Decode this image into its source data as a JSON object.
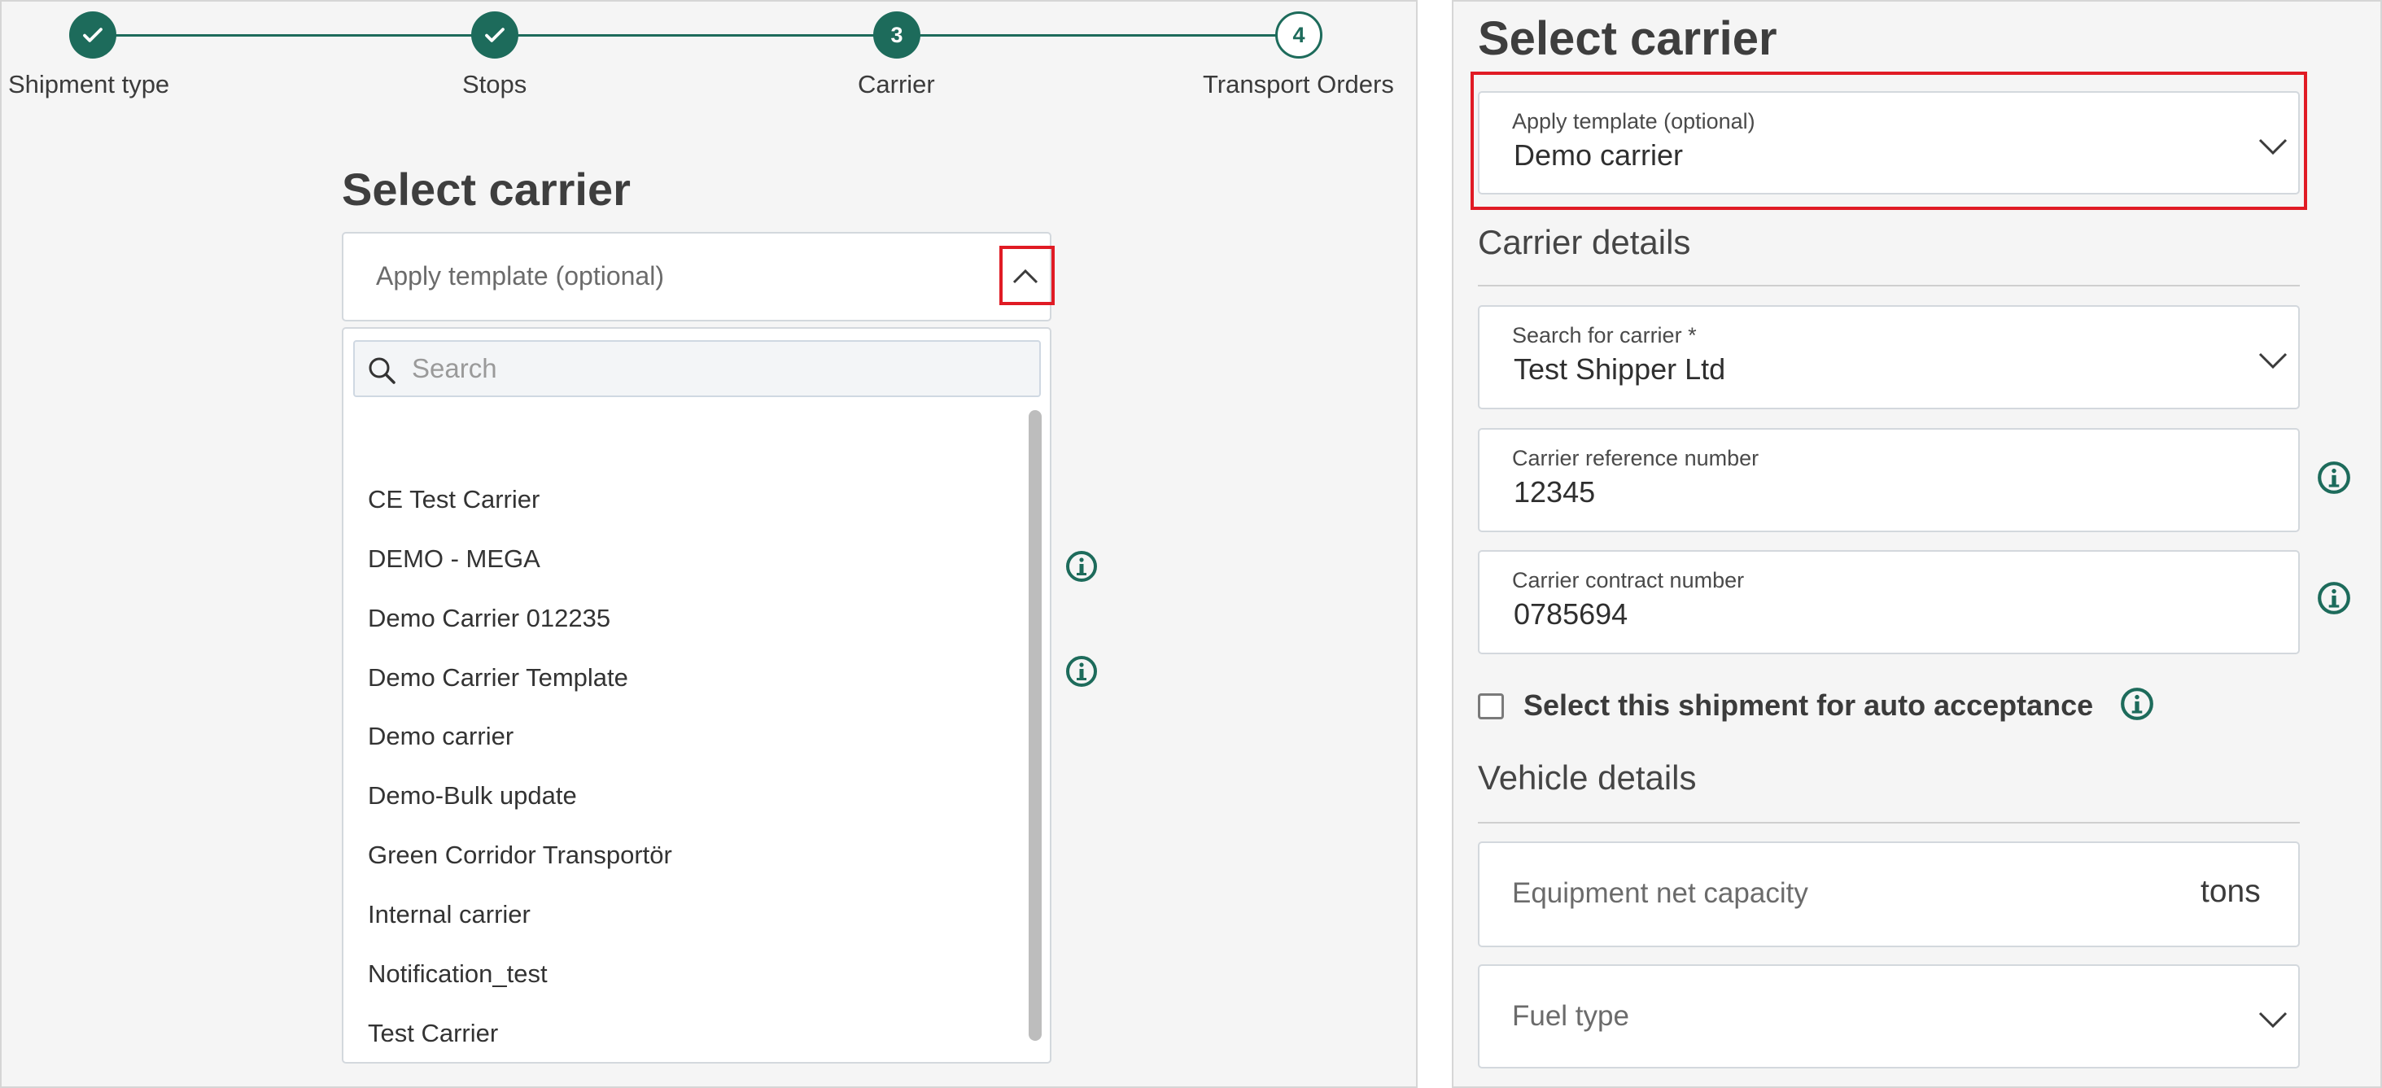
{
  "stepper": {
    "steps": [
      {
        "label": "Shipment type",
        "state": "done",
        "marker": "✓"
      },
      {
        "label": "Stops",
        "state": "done",
        "marker": "✓"
      },
      {
        "label": "Carrier",
        "state": "active",
        "marker": "3"
      },
      {
        "label": "Transport Orders",
        "state": "todo",
        "marker": "4"
      }
    ]
  },
  "left": {
    "heading": "Select carrier",
    "template_field": {
      "placeholder": "Apply template (optional)"
    },
    "dropdown": {
      "search_placeholder": "Search",
      "options": [
        "CE Test Carrier",
        "DEMO - MEGA",
        "Demo Carrier 012235",
        "Demo Carrier Template",
        "Demo carrier",
        "Demo-Bulk update",
        "Green Corridor Transportör",
        "Internal carrier",
        "Notification_test",
        "Test Carrier"
      ]
    }
  },
  "right": {
    "heading": "Select carrier",
    "template_field": {
      "label": "Apply template (optional)",
      "value": "Demo carrier"
    },
    "carrier_details": {
      "title": "Carrier details",
      "search_carrier": {
        "label": "Search for carrier *",
        "value": "Test Shipper Ltd"
      },
      "reference_number": {
        "label": "Carrier reference number",
        "value": "12345"
      },
      "contract_number": {
        "label": "Carrier contract number",
        "value": "0785694"
      }
    },
    "auto_acceptance": {
      "label": "Select this shipment for auto acceptance",
      "checked": false
    },
    "vehicle_details": {
      "title": "Vehicle details",
      "net_capacity": {
        "placeholder": "Equipment net capacity",
        "unit": "tons"
      },
      "fuel_type": {
        "placeholder": "Fuel type"
      }
    }
  },
  "colors": {
    "accent": "#1d6b5b",
    "highlight": "#e01b24"
  }
}
